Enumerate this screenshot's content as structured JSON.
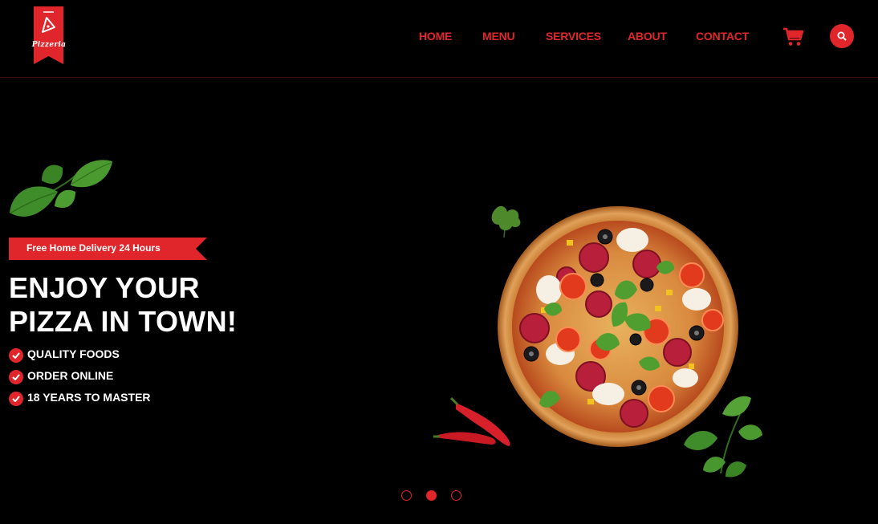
{
  "brand": {
    "name": "Pizzeria",
    "color": "#e0262b"
  },
  "nav": {
    "items": [
      {
        "label": "HOME"
      },
      {
        "label": "MENU"
      },
      {
        "label": "SERVICES"
      },
      {
        "label": "ABOUT"
      },
      {
        "label": "CONTACT"
      }
    ],
    "cart_icon": "cart-icon",
    "search_icon": "search-icon"
  },
  "hero": {
    "badge": "Free Home Delivery 24 Hours",
    "headline_line1": "ENJOY YOUR",
    "headline_line2": "PIZZA IN TOWN!",
    "features": [
      {
        "label": "QUALITY FOODS"
      },
      {
        "label": "ORDER ONLINE"
      },
      {
        "label": "18 YEARS TO MASTER"
      }
    ]
  },
  "slider": {
    "count": 3,
    "active_index": 2
  }
}
